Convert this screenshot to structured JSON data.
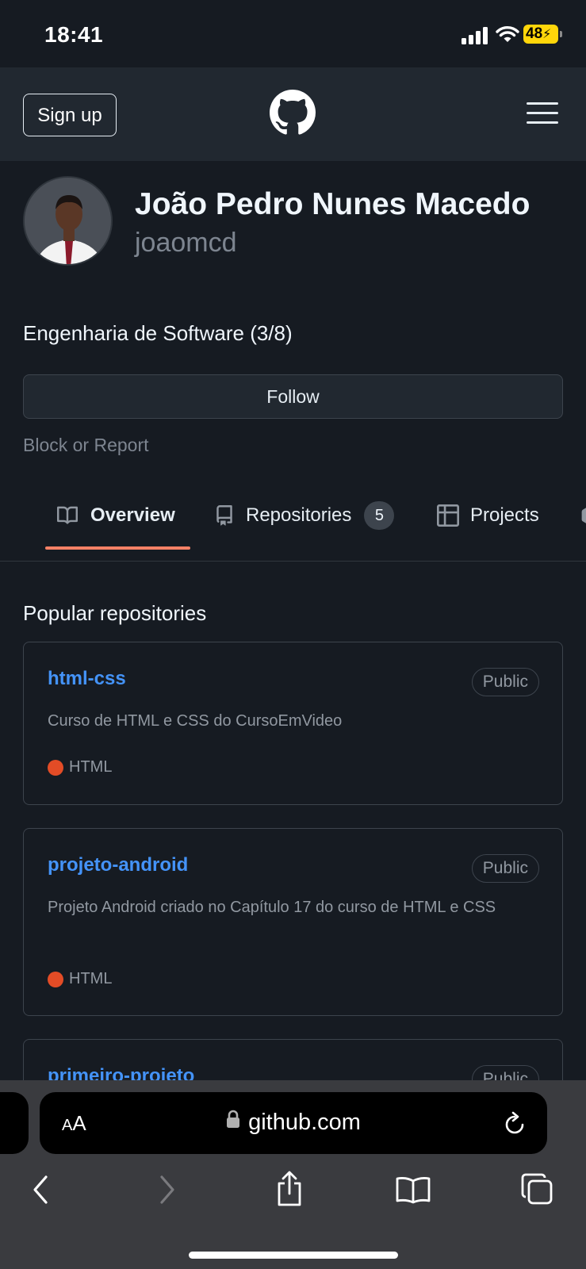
{
  "status_bar": {
    "time": "18:41",
    "battery": "48"
  },
  "header": {
    "signup_label": "Sign up"
  },
  "profile": {
    "name": "João Pedro Nunes Macedo",
    "login": "joaomcd",
    "bio": "Engenharia de Software (3/8)",
    "follow_label": "Follow",
    "block_report_label": "Block or Report"
  },
  "tabs": [
    {
      "label": "Overview",
      "active": true
    },
    {
      "label": "Repositories",
      "count": "5"
    },
    {
      "label": "Projects"
    }
  ],
  "popular": {
    "title": "Popular repositories",
    "repos": [
      {
        "name": "html-css",
        "visibility": "Public",
        "description": "Curso de HTML e CSS do CursoEmVideo",
        "language": "HTML",
        "language_color": "#e34c26"
      },
      {
        "name": "projeto-android",
        "visibility": "Public",
        "description": "Projeto Android criado no Capítulo 17 do curso de HTML e CSS",
        "language": "HTML",
        "language_color": "#e34c26"
      },
      {
        "name": "primeiro-projeto",
        "visibility": "Public"
      }
    ]
  },
  "browser": {
    "aa_label_big": "A",
    "aa_label_small": "A",
    "url": "github.com"
  },
  "colors": {
    "accent_underline": "#f78166",
    "link": "#4493f8",
    "battery": "#ffd60a"
  }
}
